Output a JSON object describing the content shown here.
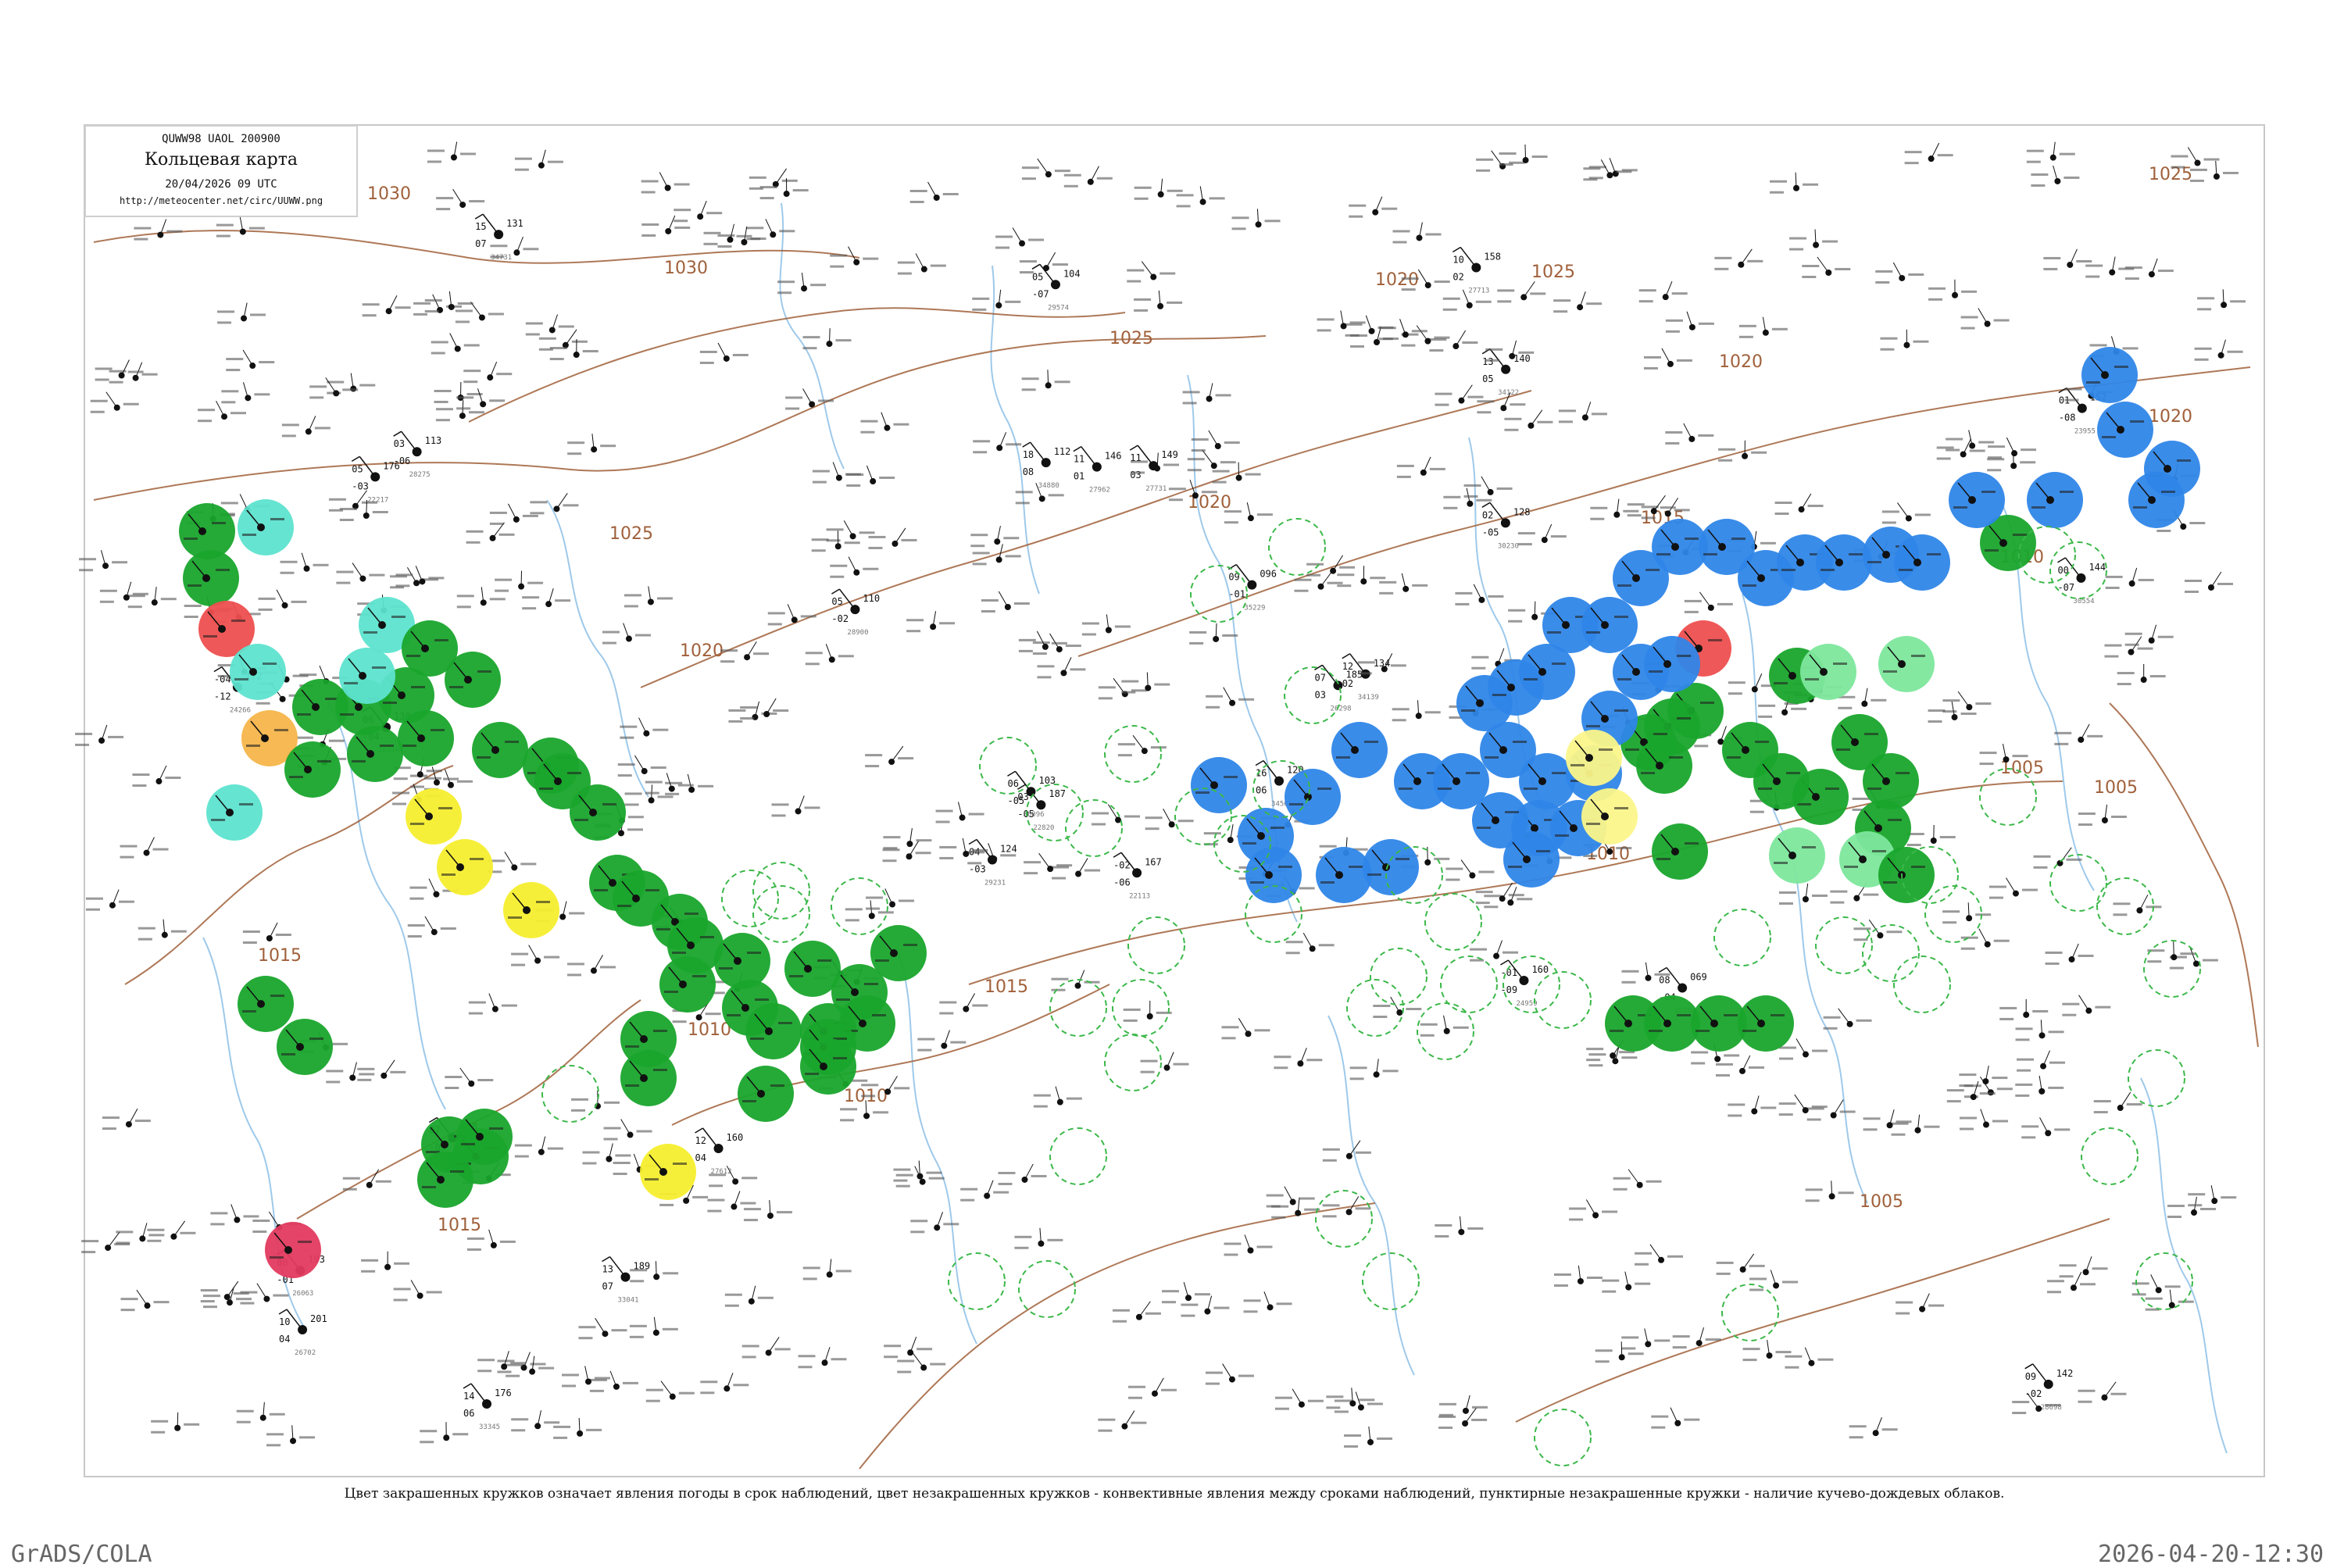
{
  "header": {
    "bulletin_code": "QUWW98  UAOL  200900",
    "title": "Кольцевая карта",
    "date": "20/04/2026 09 UTC",
    "url": "http://meteocenter.net/circ/UUWW.png"
  },
  "caption": "Цвет закрашенных кружков означает явления погоды в срок наблюдений, цвет незакрашенных кружков - конвективные явления между сроками наблюдений, пунктирные незакрашенные кружки - наличие кучево-дождевых облаков.",
  "footer": {
    "left": "GrADS/COLA",
    "right": "2026-04-20-12:30"
  },
  "isobar_labels": [
    "1030",
    "1030",
    "1025",
    "1025",
    "1025",
    "1020",
    "1020",
    "1020",
    "1020",
    "1015",
    "1015",
    "1010",
    "1010",
    "1010",
    "1005",
    "1005",
    "1005",
    "1015",
    "1010",
    "1015",
    "1025",
    "1020"
  ],
  "map_colors": {
    "frame": "#c8c8c8",
    "isobar": "#a0603a",
    "isobar_label": "#a0603a",
    "river": "#9ec9ea",
    "station": "#111111",
    "rain": "#19a52c",
    "showers": "#2f86e8",
    "light_green": "#7de79c",
    "cyan": "#5de3cf",
    "red": "#ee4f4f",
    "crimson": "#e33a5f",
    "orange": "#f5b54a",
    "yellow": "#f6ee2e",
    "pale_yellow": "#fbf58a",
    "cb_dashed": "#3cb84a"
  },
  "stations": [
    {
      "station_number": "22113",
      "temperature": "-02",
      "dewpoint": "-06",
      "pressure": "167"
    },
    {
      "station_number": "22217",
      "temperature": "05",
      "dewpoint": "-03",
      "pressure": "176"
    },
    {
      "station_number": "22820",
      "temperature": "03",
      "dewpoint": "-05",
      "pressure": "187"
    },
    {
      "station_number": "26063",
      "temperature": "08",
      "dewpoint": "-01",
      "pressure": "193"
    },
    {
      "station_number": "26298",
      "temperature": "07",
      "dewpoint": "03",
      "pressure": "185"
    },
    {
      "station_number": "27612",
      "temperature": "12",
      "dewpoint": "04",
      "pressure": "160"
    },
    {
      "station_number": "27713",
      "temperature": "10",
      "dewpoint": "02",
      "pressure": "158"
    },
    {
      "station_number": "27731",
      "temperature": "11",
      "dewpoint": "03",
      "pressure": "149"
    },
    {
      "station_number": "34122",
      "temperature": "13",
      "dewpoint": "05",
      "pressure": "140"
    },
    {
      "station_number": "34560",
      "temperature": "16",
      "dewpoint": "06",
      "pressure": "120"
    },
    {
      "station_number": "34731",
      "temperature": "15",
      "dewpoint": "07",
      "pressure": "131"
    },
    {
      "station_number": "28698",
      "temperature": "09",
      "dewpoint": "-02",
      "pressure": "142"
    },
    {
      "station_number": "28440",
      "temperature": "06",
      "dewpoint": "-04",
      "pressure": "138"
    },
    {
      "station_number": "23955",
      "temperature": "01",
      "dewpoint": "-08",
      "pressure": "152"
    },
    {
      "station_number": "29231",
      "temperature": "04",
      "dewpoint": "-03",
      "pressure": "124"
    },
    {
      "station_number": "30230",
      "temperature": "02",
      "dewpoint": "-05",
      "pressure": "128"
    },
    {
      "station_number": "33345",
      "temperature": "14",
      "dewpoint": "06",
      "pressure": "176"
    },
    {
      "station_number": "34880",
      "temperature": "18",
      "dewpoint": "08",
      "pressure": "112"
    },
    {
      "station_number": "35229",
      "temperature": "09",
      "dewpoint": "-01",
      "pressure": "096"
    },
    {
      "station_number": "36177",
      "temperature": "07",
      "dewpoint": "-03",
      "pressure": "088"
    },
    {
      "station_number": "28900",
      "temperature": "05",
      "dewpoint": "-02",
      "pressure": "110"
    },
    {
      "station_number": "26702",
      "temperature": "10",
      "dewpoint": "04",
      "pressure": "201"
    },
    {
      "station_number": "33041",
      "temperature": "13",
      "dewpoint": "07",
      "pressure": "189"
    },
    {
      "station_number": "27962",
      "temperature": "11",
      "dewpoint": "01",
      "pressure": "146"
    },
    {
      "station_number": "34139",
      "temperature": "12",
      "dewpoint": "02",
      "pressure": "134"
    },
    {
      "station_number": "35394",
      "temperature": "08",
      "dewpoint": "-04",
      "pressure": "069"
    },
    {
      "station_number": "28275",
      "temperature": "03",
      "dewpoint": "-06",
      "pressure": "113"
    },
    {
      "station_number": "29574",
      "temperature": "05",
      "dewpoint": "-07",
      "pressure": "104"
    },
    {
      "station_number": "24266",
      "temperature": "-04",
      "dewpoint": "-12",
      "pressure": "172"
    },
    {
      "station_number": "24959",
      "temperature": "-01",
      "dewpoint": "-09",
      "pressure": "160"
    },
    {
      "station_number": "30554",
      "temperature": "00",
      "dewpoint": "-07",
      "pressure": "144"
    },
    {
      "station_number": "36096",
      "temperature": "06",
      "dewpoint": "-05",
      "pressure": "103"
    }
  ]
}
